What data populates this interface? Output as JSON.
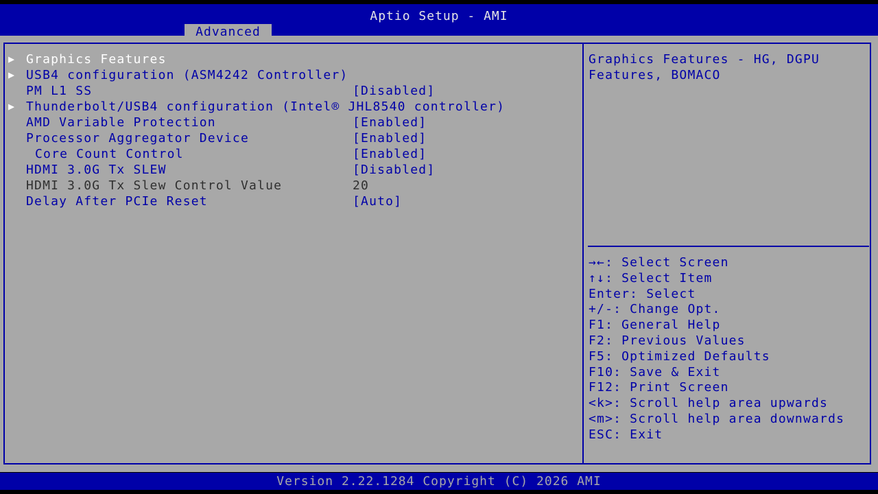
{
  "header": {
    "title": "Aptio Setup - AMI",
    "active_tab": "Advanced"
  },
  "menu": [
    {
      "type": "submenu",
      "label": "Graphics Features",
      "selected": true
    },
    {
      "type": "submenu",
      "label": "USB4 configuration (ASM4242 Controller)"
    },
    {
      "type": "option",
      "label": "PM L1 SS",
      "value": "[Disabled]"
    },
    {
      "type": "submenu",
      "label": "Thunderbolt/USB4 configuration (Intel® JHL8540 controller)"
    },
    {
      "type": "option",
      "label": "AMD Variable Protection",
      "value": "[Enabled]"
    },
    {
      "type": "option",
      "label": "Processor Aggregator Device",
      "value": "[Enabled]"
    },
    {
      "type": "option",
      "label": "Core Count Control",
      "value": "[Enabled]",
      "indent": true
    },
    {
      "type": "option",
      "label": "HDMI 3.0G Tx SLEW",
      "value": "[Disabled]"
    },
    {
      "type": "static",
      "label": "HDMI 3.0G Tx Slew Control Value",
      "value": "20"
    },
    {
      "type": "option",
      "label": "Delay After PCIe Reset",
      "value": "[Auto]"
    }
  ],
  "help": {
    "lines": [
      "Graphics Features - HG, DGPU",
      "Features, BOMACO"
    ]
  },
  "keys": [
    "→←: Select Screen",
    "↑↓: Select Item",
    "Enter: Select",
    "+/-: Change Opt.",
    "F1: General Help",
    "F2: Previous Values",
    "F5: Optimized Defaults",
    "F10: Save & Exit",
    "F12: Print Screen",
    "<k>: Scroll help area upwards",
    "<m>: Scroll help area downwards",
    "ESC: Exit"
  ],
  "footer": {
    "version": "Version 2.22.1284 Copyright (C) 2026 AMI"
  },
  "colors": {
    "background": "#a8a8a8",
    "accent": "#0000a8",
    "selected_text": "#ffffff"
  }
}
